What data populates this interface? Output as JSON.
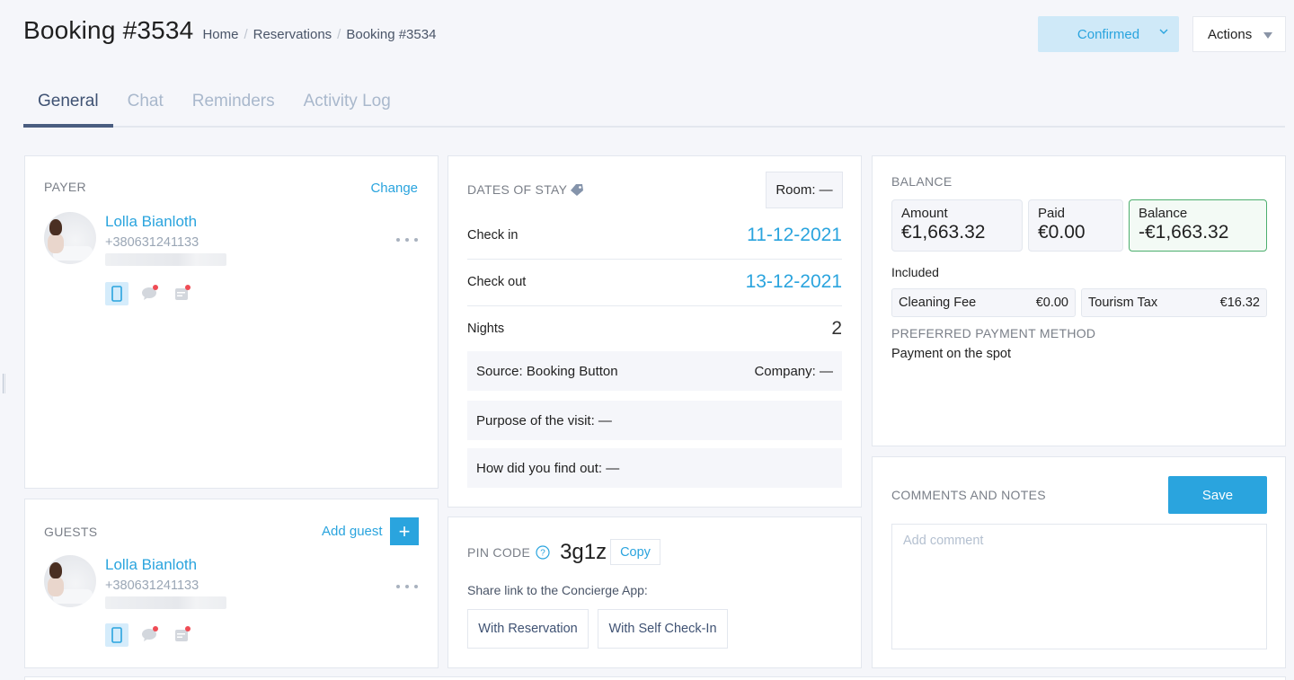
{
  "header": {
    "title": "Booking #3534",
    "breadcrumb": [
      "Home",
      "Reservations",
      "Booking #3534"
    ],
    "breadcrumb_separator": "/",
    "status_label": "Confirmed",
    "actions_label": "Actions"
  },
  "tabs": [
    {
      "label": "General",
      "active": true
    },
    {
      "label": "Chat",
      "active": false
    },
    {
      "label": "Reminders",
      "active": false
    },
    {
      "label": "Activity Log",
      "active": false
    }
  ],
  "payer": {
    "section_label": "PAYER",
    "change_label": "Change",
    "name": "Lolla Bianloth",
    "phone": "+380631241133",
    "email": "",
    "channels": [
      {
        "icon": "mobile-icon",
        "active": true,
        "notification": false
      },
      {
        "icon": "chat-bubble-icon",
        "active": false,
        "notification": true
      },
      {
        "icon": "message-icon",
        "active": false,
        "notification": true
      }
    ]
  },
  "guests": {
    "section_label": "GUESTS",
    "add_label": "Add guest",
    "add_icon": "+",
    "list": [
      {
        "name": "Lolla Bianloth",
        "phone": "+380631241133"
      }
    ]
  },
  "dates": {
    "section_label": "DATES OF STAY",
    "room_label": "Room: —",
    "check_in_label": "Check in",
    "check_in": "11-12-2021",
    "check_out_label": "Check out",
    "check_out": "13-12-2021",
    "nights_label": "Nights",
    "nights": "2",
    "source_label": "Source:",
    "source_value": "Booking Button",
    "company_label": "Company: —",
    "purpose_label": "Purpose of the visit: —",
    "found_label": "How did you find out: —"
  },
  "pin": {
    "section_label": "PIN CODE",
    "code": "3g1z",
    "copy_label": "Copy",
    "share_label": "Share link to the Concierge App:",
    "with_reservation_label": "With Reservation",
    "with_self_checkin_label": "With Self Check-In"
  },
  "balance": {
    "section_label": "BALANCE",
    "amount_label": "Amount",
    "amount": "€1,663.32",
    "paid_label": "Paid",
    "paid": "€0.00",
    "balance_label": "Balance",
    "balance": "-€1,663.32",
    "included_label": "Included",
    "fees": [
      {
        "label": "Cleaning Fee",
        "value": "€0.00"
      },
      {
        "label": "Tourism Tax",
        "value": "€16.32"
      }
    ],
    "payment_method_label": "PREFERRED PAYMENT METHOD",
    "payment_method": "Payment on the spot"
  },
  "comments": {
    "section_label": "COMMENTS AND NOTES",
    "save_label": "Save",
    "placeholder": "Add comment",
    "value": ""
  },
  "colors": {
    "accent": "#2aa4de",
    "status_bg": "#cfe9f8",
    "balance_border": "#4cae6e",
    "notification": "#ef4c55",
    "tab_active": "#3f5273"
  }
}
